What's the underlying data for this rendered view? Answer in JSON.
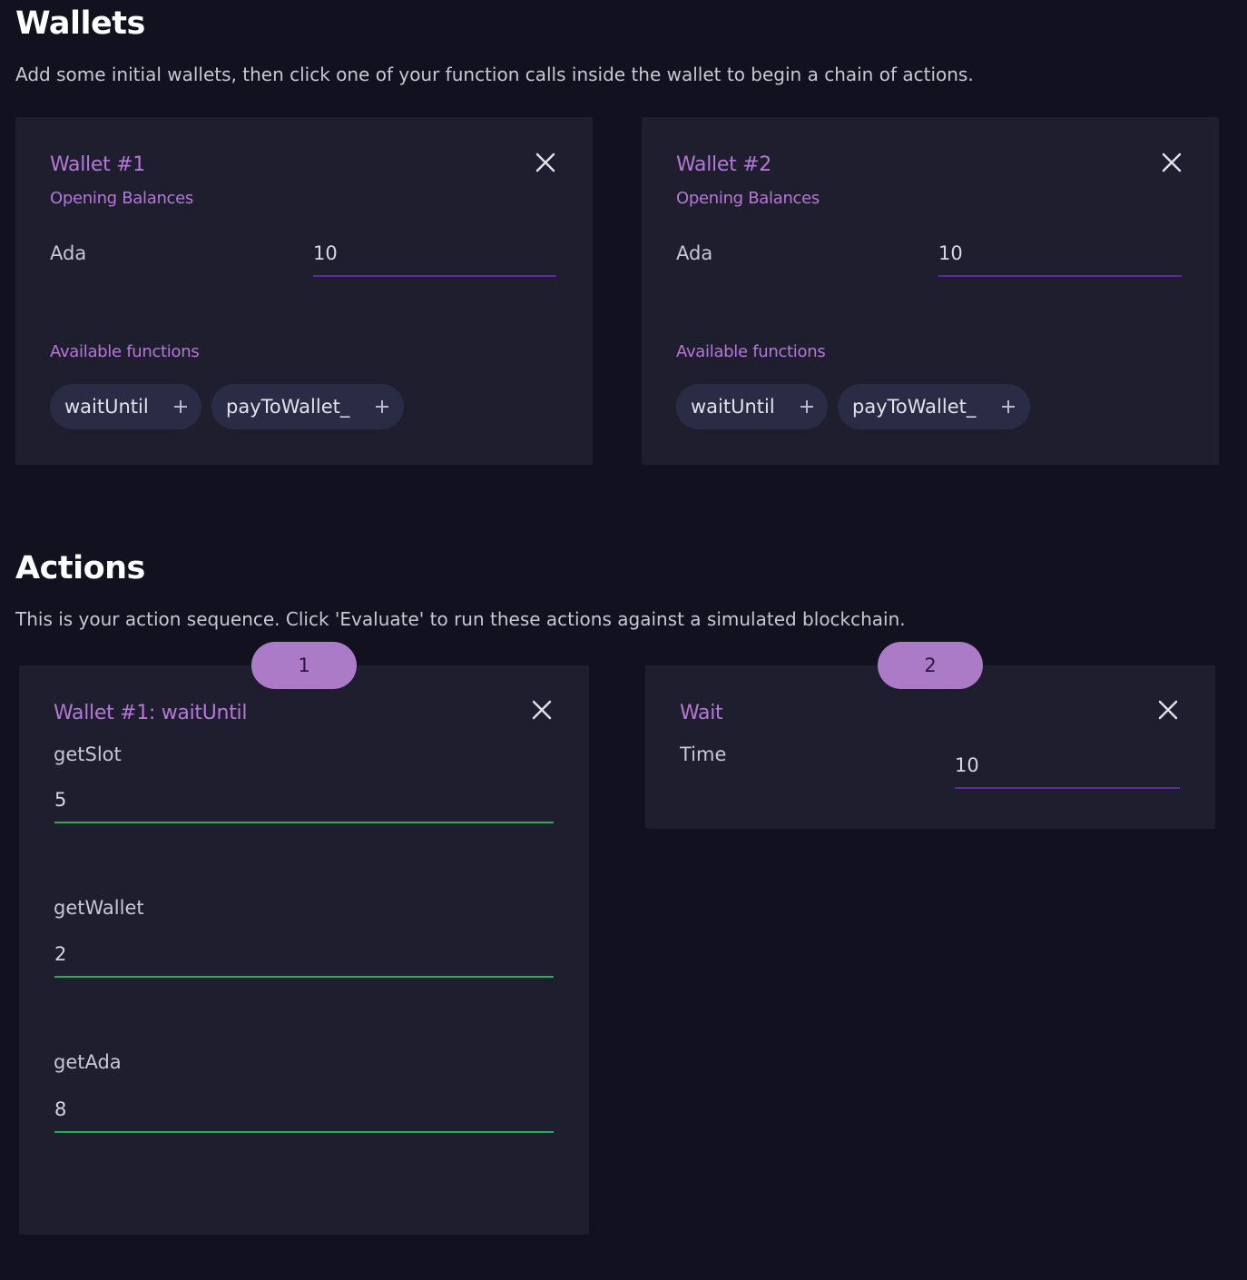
{
  "wallets_section": {
    "title": "Wallets",
    "description": "Add some initial wallets, then click one of your function calls inside the wallet to begin a chain of actions.",
    "wallets": [
      {
        "title": "Wallet #1",
        "opening_balances_label": "Opening Balances",
        "currency_label": "Ada",
        "currency_value": "10",
        "functions_label": "Available functions",
        "functions": [
          "waitUntil",
          "payToWallet_"
        ]
      },
      {
        "title": "Wallet #2",
        "opening_balances_label": "Opening Balances",
        "currency_label": "Ada",
        "currency_value": "10",
        "functions_label": "Available functions",
        "functions": [
          "waitUntil",
          "payToWallet_"
        ]
      }
    ]
  },
  "actions_section": {
    "title": "Actions",
    "description": "This is your action sequence. Click 'Evaluate' to run these actions against a simulated blockchain.",
    "actions": [
      {
        "sequence": "1",
        "title": "Wallet #1: waitUntil",
        "fields": [
          {
            "label": "getSlot",
            "value": "5"
          },
          {
            "label": "getWallet",
            "value": "2"
          },
          {
            "label": "getAda",
            "value": "8"
          }
        ]
      },
      {
        "sequence": "2",
        "title": "Wait",
        "fields": [
          {
            "label": "Time",
            "value": "10"
          }
        ]
      }
    ]
  },
  "colors": {
    "background": "#11111f",
    "card": "#1e1e2f",
    "accent_purple": "#b578d8",
    "badge": "#ab7bc7",
    "chip": "#2a2b45",
    "valid_underline": "#2ea85a",
    "default_underline": "#5c2a9d"
  },
  "icons": {
    "close": "close-icon",
    "add": "plus-icon"
  }
}
